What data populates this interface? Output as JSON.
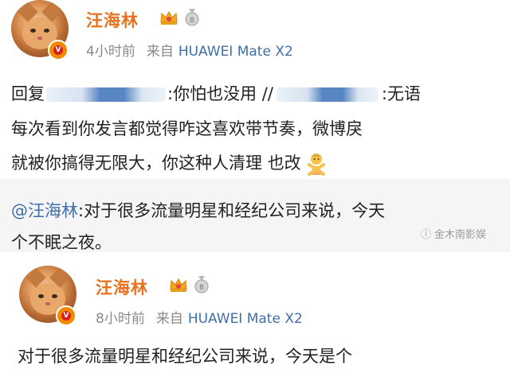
{
  "post1": {
    "username": "汪海林",
    "time": "4小时前",
    "from_label": "来自",
    "device": "HUAWEI Mate X2",
    "reply_prefix": "回复",
    "reply_text1": ":你怕也没用 //",
    "reply_text2": ":无语",
    "line2": "每次看到你发言都觉得咋这喜欢带节奏，微博戾",
    "line3": "就被你搞得无限大，你这种人清理 也改"
  },
  "repost": {
    "mention": "@汪海林",
    "text1": ":对于很多流量明星和经纪公司来说，今天",
    "text2": "个不眠之夜。"
  },
  "watermark": "金木南影娱",
  "post2": {
    "username": "汪海林",
    "time": "8小时前",
    "from_label": "来自",
    "device": "HUAWEI Mate X2",
    "line1": "对于很多流量明星和经纪公司来说，今天是个"
  },
  "colors": {
    "username": "#e8711f",
    "link": "#3f6fa8",
    "meta": "#8a8a8a",
    "repost_bg": "#f5f5f5"
  }
}
